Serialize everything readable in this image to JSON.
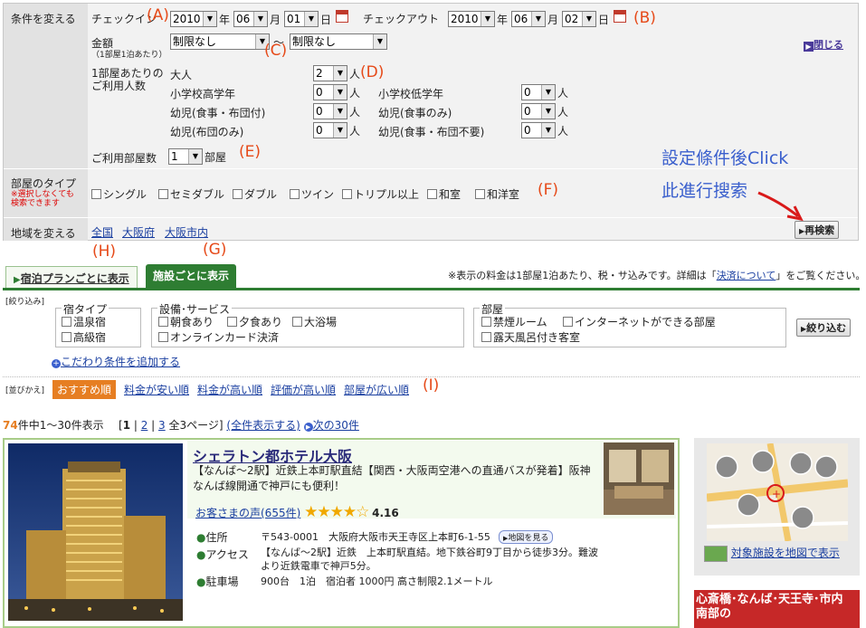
{
  "search": {
    "change_conditions": "条件を変える",
    "checkin_label": "チェックイン",
    "checkin": {
      "year": "2010",
      "year_unit": "年",
      "month": "06",
      "month_unit": "月",
      "day": "01",
      "day_unit": "日"
    },
    "checkout_label": "チェックアウト",
    "checkout": {
      "year": "2010",
      "year_unit": "年",
      "month": "06",
      "month_unit": "月",
      "day": "02",
      "day_unit": "日"
    },
    "price_label": "金額",
    "price_sub": "（1部屋1泊あたり）",
    "price_min": "制限なし",
    "price_tilde": "～",
    "price_max": "制限なし",
    "close_label": "閉じる",
    "per_room_label_1": "1部屋あたりの",
    "per_room_label_2": "ご利用人数",
    "adult_label": "大人",
    "adult_value": "2",
    "unit_person": "人",
    "child_labels": [
      "小学校高学年",
      "小学校低学年",
      "幼児(食事・布団付)",
      "幼児(食事のみ)",
      "幼児(布団のみ)",
      "幼児(食事・布団不要)"
    ],
    "child_values": [
      "0",
      "0",
      "0",
      "0",
      "0",
      "0"
    ],
    "rooms_label": "ご利用部屋数",
    "rooms_value": "1",
    "rooms_unit": "部屋",
    "room_type_label": "部屋のタイプ",
    "room_type_note_1": "※選択しなくても",
    "room_type_note_2": "検索できます",
    "room_types": [
      "シングル",
      "セミダブル",
      "ダブル",
      "ツイン",
      "トリプル以上",
      "和室",
      "和洋室"
    ],
    "area_label": "地域を変える",
    "area_links": [
      "全国",
      "大阪府",
      "大阪市内"
    ],
    "research_button": "再検索"
  },
  "annotations": {
    "a": "(A)",
    "b": "(B)",
    "c": "(C)",
    "d": "(D)",
    "e": "(E)",
    "f": "(F)",
    "g": "(G)",
    "h": "(H)",
    "i": "(I)",
    "note_1": "設定條件後Click",
    "note_2": "此進行搜索"
  },
  "tabs": {
    "plan": "宿泊プランごとに表示",
    "facility": "施設ごとに表示",
    "price_note_1": "※表示の料金は1部屋1泊あたり、税・サ込みです。詳細は「",
    "price_note_link": "決済について",
    "price_note_2": "」をご覧ください。"
  },
  "filters": {
    "title": "[絞り込み]",
    "inn_type_title": "宿タイプ",
    "inn_types": [
      "温泉宿",
      "高級宿"
    ],
    "facility_title": "設備･サービス",
    "facilities": [
      "朝食あり",
      "夕食あり",
      "大浴場",
      "オンラインカード決済"
    ],
    "room_title": "部屋",
    "rooms": [
      "禁煙ルーム",
      "インターネットができる部屋",
      "露天風呂付き客室"
    ],
    "apply_button": "絞り込む",
    "add_conditions": "こだわり条件を追加する"
  },
  "sort": {
    "title": "[並びかえ]",
    "options": [
      "おすすめ順",
      "料金が安い順",
      "料金が高い順",
      "評価が高い順",
      "部屋が広い順"
    ],
    "active": "おすすめ順"
  },
  "results": {
    "count": "74",
    "count_suffix": "件中1～30件表示",
    "pages_open": "[",
    "page1": "1",
    "page2": "2",
    "page3": "3",
    "pages_total": "全3ページ]",
    "show_all": "(全件表示する)",
    "next": "次の30件"
  },
  "hotel": {
    "name": "シェラトン都ホテル大阪",
    "description": "【なんば～2駅】近鉄上本町駅直結【関西・大阪両空港への直通バスが発着】阪神なんば線開通で神戸にも便利！",
    "reviews": "お客さまの声(655件)",
    "stars": "★★★★☆",
    "rating": "4.16",
    "address_label": "住所",
    "address": "〒543-0001　大阪府大阪市天王寺区上本町6-1-55",
    "map_button": "地図を見る",
    "access_label": "アクセス",
    "access": "【なんば～2駅】近鉄　上本町駅直結。地下鉄谷町9丁目から徒歩3分。難波より近鉄電車で神戸5分。",
    "parking_label": "駐車場",
    "parking": "900台　1泊　宿泊者 1000円 高さ制限2.1メートル"
  },
  "side": {
    "map_link": "対象施設を地図で表示",
    "banner_1": "心斎橋･なんば･天王寺･市内",
    "banner_2": "南部の"
  },
  "colors": {
    "annotation": "#e64a19",
    "note": "#3a5fcd",
    "link": "#1a3fa0",
    "tab_active": "#2e7d32",
    "sort_active": "#e67e22",
    "count": "#e67e22"
  }
}
